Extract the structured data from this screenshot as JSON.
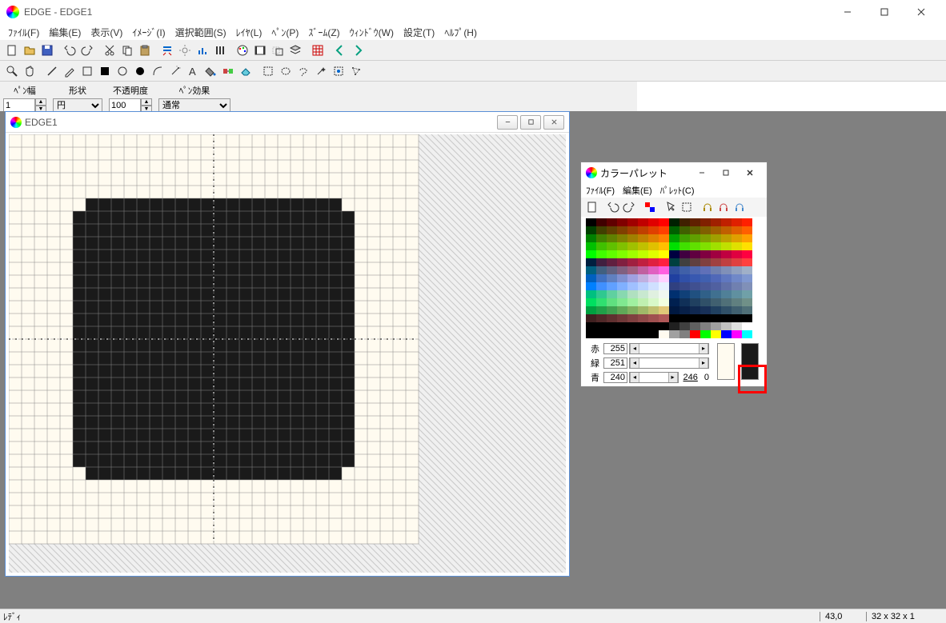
{
  "app": {
    "title": "EDGE - EDGE1"
  },
  "menu": {
    "file": "ﾌｧｲﾙ(F)",
    "edit": "編集(E)",
    "view": "表示(V)",
    "image": "ｲﾒｰｼﾞ(I)",
    "select": "選択範囲(S)",
    "layer": "ﾚｲﾔ(L)",
    "pen": "ﾍﾟﾝ(P)",
    "zoom": "ｽﾞｰﾑ(Z)",
    "window": "ｳｨﾝﾄﾞｳ(W)",
    "settings": "設定(T)",
    "help": "ﾍﾙﾌﾟ(H)"
  },
  "brush": {
    "width_label": "ﾍﾟﾝ幅",
    "width_value": "1",
    "shape_label": "形状",
    "shape_value": "円",
    "opacity_label": "不透明度",
    "opacity_value": "100",
    "effect_label": "ﾍﾟﾝ効果",
    "effect_value": "通常"
  },
  "doc": {
    "title": "EDGE1"
  },
  "palette": {
    "title": "カラーパレット",
    "menu_file": "ﾌｧｲﾙ(F)",
    "menu_edit": "編集(E)",
    "menu_palette": "ﾊﾟﾚｯﾄ(C)",
    "r_label": "赤",
    "g_label": "緑",
    "b_label": "青",
    "r_value": "255",
    "g_value": "251",
    "b_value": "240",
    "extra_246": "246",
    "extra_0": "0",
    "colors": [
      [
        "#000000",
        "#400000",
        "#600000",
        "#800000",
        "#a00000",
        "#c00000",
        "#e00000",
        "#ff0000",
        "#002000",
        "#402000",
        "#602000",
        "#802000",
        "#a02000",
        "#c02000",
        "#e02000",
        "#ff2000"
      ],
      [
        "#004000",
        "#404000",
        "#604000",
        "#804000",
        "#a04000",
        "#c04000",
        "#e04000",
        "#ff4000",
        "#006000",
        "#406000",
        "#606000",
        "#806000",
        "#a06000",
        "#c06000",
        "#e06000",
        "#ff6000"
      ],
      [
        "#008000",
        "#408000",
        "#608000",
        "#808000",
        "#a08000",
        "#c08000",
        "#e08000",
        "#ff8000",
        "#00a000",
        "#40a000",
        "#60a000",
        "#80a000",
        "#a0a000",
        "#c0a000",
        "#e0a000",
        "#ffa000"
      ],
      [
        "#00c000",
        "#40c000",
        "#60c000",
        "#80c000",
        "#a0c000",
        "#c0c000",
        "#e0c000",
        "#ffc000",
        "#00e000",
        "#40e000",
        "#60e000",
        "#80e000",
        "#a0e000",
        "#c0e000",
        "#e0e000",
        "#ffe000"
      ],
      [
        "#00ff00",
        "#40ff00",
        "#60ff00",
        "#80ff00",
        "#a0ff00",
        "#c0ff00",
        "#e0ff00",
        "#ffff00",
        "#000040",
        "#400040",
        "#600040",
        "#800040",
        "#a00040",
        "#c00040",
        "#e00040",
        "#ff0040"
      ],
      [
        "#002040",
        "#402040",
        "#602040",
        "#802040",
        "#a02040",
        "#c02040",
        "#e02040",
        "#ff2040",
        "#004040",
        "#404040",
        "#604040",
        "#804040",
        "#a04040",
        "#c04040",
        "#e04040",
        "#ff4040"
      ],
      [
        "#006080",
        "#406080",
        "#606080",
        "#806080",
        "#a06080",
        "#c060a0",
        "#e060c0",
        "#ff60e0",
        "#3050a0",
        "#4060a8",
        "#5068b0",
        "#6070b8",
        "#7080b0",
        "#8090b8",
        "#90a0c0",
        "#a0b0c8"
      ],
      [
        "#0060c0",
        "#4070c0",
        "#6080c0",
        "#8090d0",
        "#a0a0e0",
        "#c0b0e0",
        "#e0c0f0",
        "#ffd0ff",
        "#2040a0",
        "#3050a8",
        "#3858b0",
        "#4060b0",
        "#5068b8",
        "#6078c0",
        "#7088c8",
        "#8098d0"
      ],
      [
        "#0080ff",
        "#4090ff",
        "#60a0ff",
        "#80b0ff",
        "#a0c0ff",
        "#b8d0ff",
        "#d0e0ff",
        "#e8f0ff",
        "#304080",
        "#384888",
        "#405090",
        "#485898",
        "#5060a0",
        "#6070a8",
        "#7080b0",
        "#8090b8"
      ],
      [
        "#00c080",
        "#30c890",
        "#60d0a0",
        "#88d8b0",
        "#b0e0c0",
        "#c8e8d0",
        "#e0f0e0",
        "#f0f8f0",
        "#003070",
        "#104078",
        "#205080",
        "#306088",
        "#407090",
        "#508098",
        "#6090a0",
        "#70a0a8"
      ],
      [
        "#00e060",
        "#30e070",
        "#60e080",
        "#80e890",
        "#a0f0a0",
        "#c0f0b0",
        "#d8f8c8",
        "#f0ffe0",
        "#002050",
        "#103058",
        "#204060",
        "#305068",
        "#406070",
        "#507078",
        "#608080",
        "#709088"
      ],
      [
        "#00a040",
        "#20a048",
        "#40a050",
        "#60a858",
        "#80b060",
        "#a0b868",
        "#c0c070",
        "#e0c878",
        "#001840",
        "#082048",
        "#102850",
        "#183058",
        "#204060",
        "#305068",
        "#406070",
        "#507078"
      ],
      [
        "#402020",
        "#502828",
        "#603030",
        "#703838",
        "#804040",
        "#904848",
        "#a05050",
        "#b05858",
        "#000000",
        "#000000",
        "#000000",
        "#000000",
        "#000000",
        "#000000",
        "#000000",
        "#000000"
      ],
      [
        "#000000",
        "#000000",
        "#000000",
        "#000000",
        "#000000",
        "#000000",
        "#000000",
        "#000000",
        "#202020",
        "#404040",
        "#606060",
        "#808080",
        "#a0a0a0",
        "#c0c0c0",
        "#e0e0e0",
        "#ffffff"
      ],
      [
        "#000000",
        "#000000",
        "#000000",
        "#000000",
        "#000000",
        "#000000",
        "#000000",
        "#fffbf0",
        "#a0a0a0",
        "#808080",
        "#ff0000",
        "#00ff00",
        "#ffff00",
        "#0000ff",
        "#ff00ff",
        "#00ffff"
      ]
    ]
  },
  "status": {
    "ready": "ﾚﾃﾞｨ",
    "coords": "43,0",
    "dims": "32 x 32 x 1"
  }
}
